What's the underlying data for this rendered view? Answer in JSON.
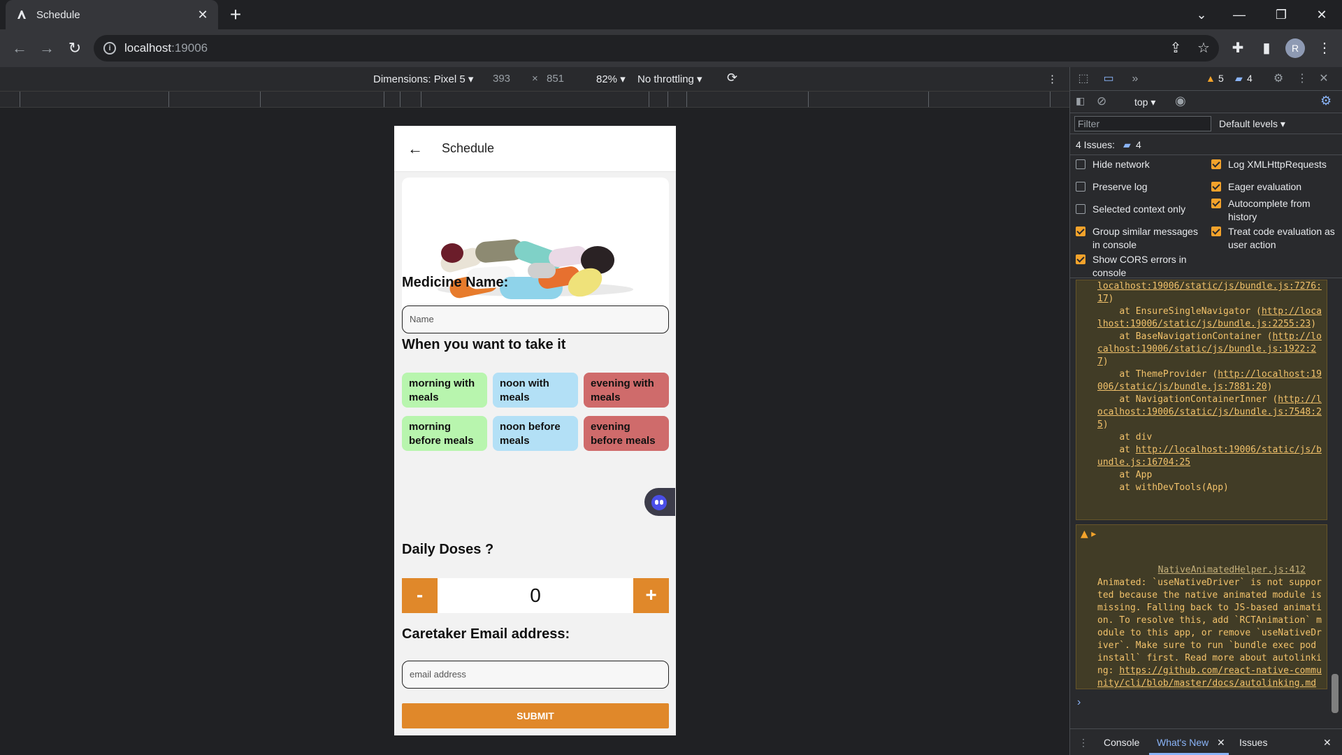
{
  "browser": {
    "tab_title": "Schedule",
    "url_host": "localhost",
    "url_port": ":19006"
  },
  "device_toolbar": {
    "dimensions_label": "Dimensions: Pixel 5 ▾",
    "width": "393",
    "times": "×",
    "height": "851",
    "zoom": "82% ▾",
    "throttling": "No throttling ▾"
  },
  "app": {
    "header_title": "Schedule",
    "medicine_label": "Medicine Name:",
    "name_placeholder": "Name",
    "when_label": "When you want to take it",
    "times": [
      "morning with meals",
      "noon with meals",
      "evening with meals",
      "morning before meals",
      "noon before meals",
      "evening before meals"
    ],
    "doses_label": "Daily Doses ?",
    "minus": "-",
    "plus": "+",
    "dose_value": "0",
    "email_label": "Caretaker Email address:",
    "email_placeholder": "email address",
    "submit_label": "SUBMIT"
  },
  "devtools": {
    "warnings_count": "5",
    "messages_count": "4",
    "context": "top ▾",
    "filter_placeholder": "Filter",
    "levels": "Default levels ▾",
    "issues_label": "4 Issues:",
    "issues_count": "4",
    "options": {
      "hide_network": "Hide network",
      "preserve_log": "Preserve log",
      "selected_context": "Selected context only",
      "group_similar": "Group similar messages in console",
      "show_cors": "Show CORS errors in console",
      "log_xhr": "Log XMLHttpRequests",
      "eager_eval": "Eager evaluation",
      "autocomplete": "Autocomplete from history",
      "treat_code": "Treat code evaluation as user action"
    },
    "stack": {
      "l1_link": "localhost:19006/static/js/bundle.js:7276:17",
      "l1_end": ")",
      "l2_pre": "    at EnsureSingleNavigator (",
      "l2_link": "http://localhost:19006/static/js/bundle.js:2255:23",
      "l3_pre": "    at BaseNavigationContainer (",
      "l3_link": "http://localhost:19006/static/js/bundle.js:1922:27",
      "l4_pre": "    at ThemeProvider (",
      "l4_link": "http://localhost:19006/static/js/bundle.js:7881:20",
      "l5_pre": "    at NavigationContainerInner (",
      "l5_link": "http://localhost:19006/static/js/bundle.js:7548:25",
      "l6": "    at div",
      "l7_pre": "    at ",
      "l7_link": "http://localhost:19006/static/js/bundle.js:16704:25",
      "l8": "    at App",
      "l9": "    at withDevTools(App)"
    },
    "warning": {
      "source": "NativeAnimatedHelper.js:412",
      "text": "Animated: `useNativeDriver` is not supported because the native animated module is missing. Falling back to JS-based animation. To resolve this, add `RCTAnimation` module to this app, or remove `useNativeDriver`. Make sure to run `bundle exec pod install` first. Read more about autolinking: ",
      "link": "https://github.com/react-native-community/cli/blob/master/docs/autolinking.md"
    },
    "prompt": "›",
    "drawer_tabs": [
      "Console",
      "What's New",
      "Issues"
    ]
  },
  "colors": {
    "accent": "#e0882a",
    "chip_green": "#b8f5ae",
    "chip_blue": "#b3e0f6",
    "chip_red": "#cf6b6b",
    "warning_bg": "#413c26"
  }
}
